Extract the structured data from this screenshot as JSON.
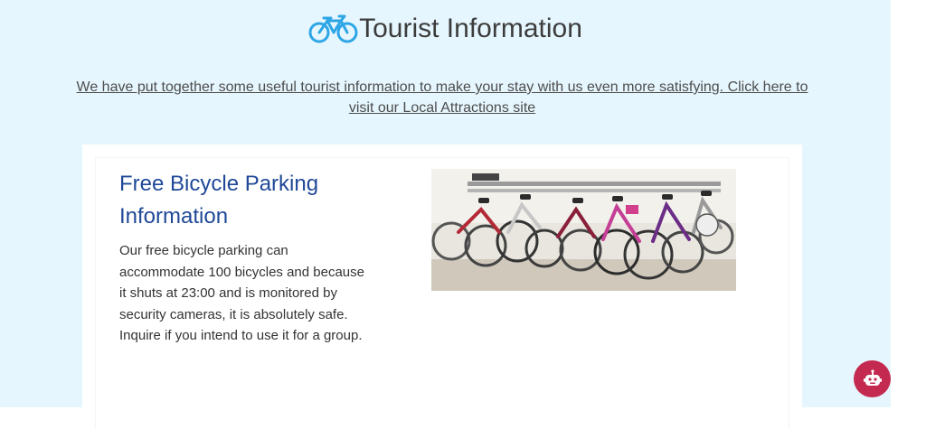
{
  "header": {
    "icon": "bicycle-icon",
    "title": "Tourist Information"
  },
  "intro": {
    "text": "We have put together some useful tourist information to make your stay with us even more satisfying. Click here to visit our Local Attractions site"
  },
  "card": {
    "title": "Free Bicycle Parking Information",
    "body": "Our free bicycle parking can accommodate 100 bicycles and because it shuts at 23:00 and is monitored by security cameras, it is absolutely safe. Inquire if you intend to use it for a group.",
    "image": "bicycle-parking-photo"
  },
  "chat": {
    "icon": "chatbot-icon"
  },
  "colors": {
    "background": "#e6f6fe",
    "icon_blue": "#2ea6e6",
    "card_title": "#1f4897",
    "chat_button": "#c4294f"
  }
}
